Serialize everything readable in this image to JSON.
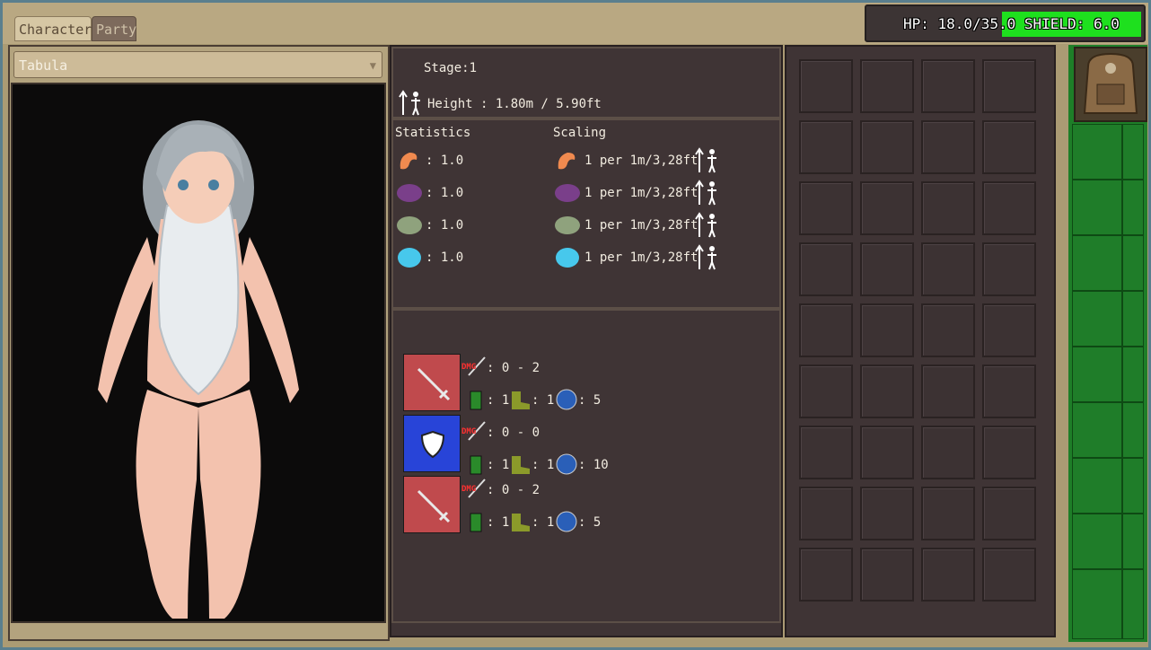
{
  "tabs": [
    {
      "label": "Character"
    },
    {
      "label": "Party"
    }
  ],
  "hud": {
    "hp_label": "HP: 18.0/35.0",
    "shield_label": "SHIELD: 6.0",
    "hp_value": 18.0,
    "hp_max": 35.0,
    "shield_value": 6.0,
    "shield_color": "#1ee01e"
  },
  "character": {
    "name": "Tabula"
  },
  "info": {
    "stage_label": "Stage:1",
    "height_label": "Height : 1.80m / 5.90ft"
  },
  "statistics": {
    "title": "Statistics",
    "rows": [
      {
        "icon": "muscle-icon",
        "value": ": 1.0"
      },
      {
        "icon": "purple-orb-icon",
        "value": ": 1.0"
      },
      {
        "icon": "green-orb-icon",
        "value": ": 1.0"
      },
      {
        "icon": "cyan-gem-icon",
        "value": ": 1.0"
      }
    ]
  },
  "scaling": {
    "title": "Scaling",
    "rows": [
      {
        "icon": "muscle-icon",
        "value": "1 per 1m/3,28ft"
      },
      {
        "icon": "purple-orb-icon",
        "value": "1 per 1m/3,28ft"
      },
      {
        "icon": "green-orb-icon",
        "value": "1 per 1m/3,28ft"
      },
      {
        "icon": "cyan-gem-icon",
        "value": "1 per 1m/3,28ft"
      }
    ]
  },
  "equipment": [
    {
      "type": "sword",
      "dmg_label": "DMG",
      "dmg": ": 0 - 2",
      "energy": ": 1",
      "speed": ": 1",
      "time": ": 5"
    },
    {
      "type": "shield",
      "dmg_label": "DMG",
      "dmg": ": 0 - 0",
      "energy": ": 1",
      "speed": ": 1",
      "time": ": 10"
    },
    {
      "type": "sword",
      "dmg_label": "DMG",
      "dmg": ": 0 - 2",
      "energy": ": 1",
      "speed": ": 1",
      "time": ": 5"
    }
  ]
}
